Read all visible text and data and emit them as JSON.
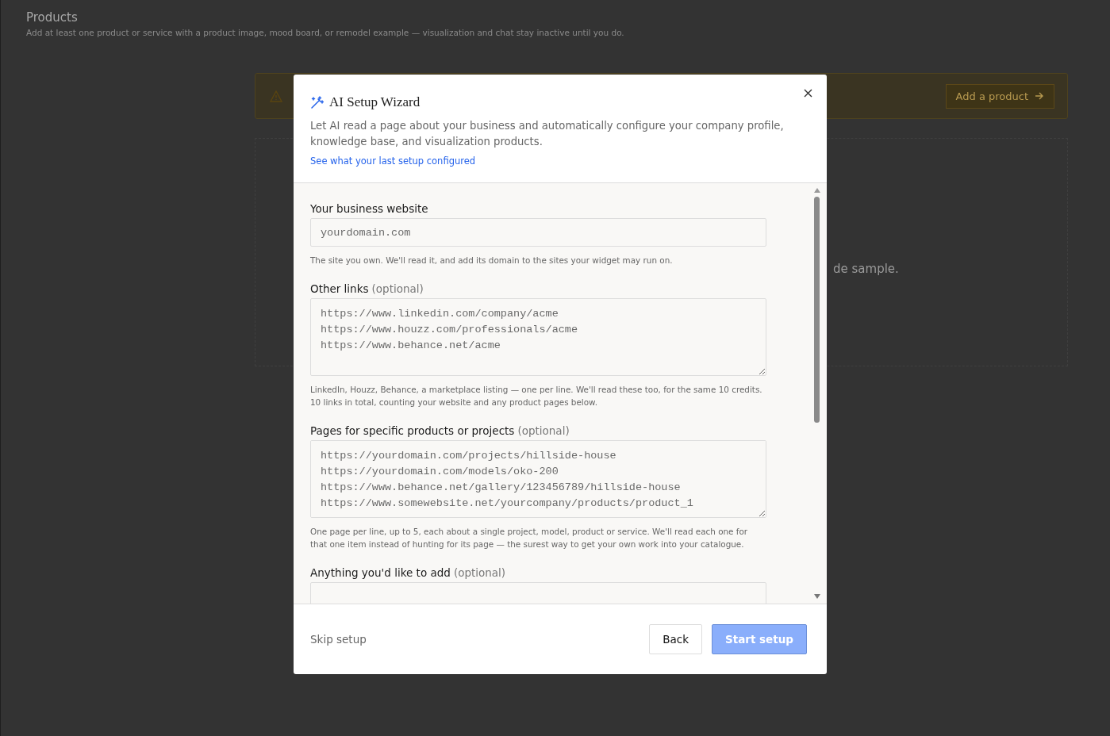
{
  "page": {
    "title": "Products",
    "subtitle": "Add at least one product or service with a product image, mood board, or remodel example — visualization and chat stay inactive until you do.",
    "banner": {
      "button": "Add a product"
    },
    "card": {
      "text": "de sample."
    }
  },
  "dialog": {
    "title": "AI Setup Wizard",
    "description": "Let AI read a page about your business and automatically configure your company profile, knowledge base, and visualization products.",
    "link": "See what your last setup configured",
    "fields": [
      {
        "kind": "input",
        "label": "Your business website",
        "placeholder": "yourdomain.com",
        "help": "The site you own. We'll read it, and add its domain to the sites your widget may run on."
      },
      {
        "kind": "textarea",
        "label": "Other links",
        "optional": "(optional)",
        "placeholder": "https://www.linkedin.com/company/acme\nhttps://www.houzz.com/professionals/acme\nhttps://www.behance.net/acme",
        "help": "LinkedIn, Houzz, Behance, a marketplace listing — one per line. We'll read these too, for the same 10 credits. 10 links in total, counting your website and any product pages below."
      },
      {
        "kind": "textarea",
        "label": "Pages for specific products or projects",
        "optional": "(optional)",
        "placeholder": "https://yourdomain.com/projects/hillside-house\nhttps://yourdomain.com/models/oko-200\nhttps://www.behance.net/gallery/123456789/hillside-house\nhttps://www.somewebsite.net/yourcompany/products/product_1",
        "help": "One page per line, up to 5, each about a single project, model, product or service. We'll read each one for that one item instead of hunting for its page — the surest way to get your own work into your catalogue."
      },
      {
        "kind": "textarea",
        "label": "Anything you'd like to add",
        "optional": "(optional)"
      }
    ],
    "footer": {
      "skip": "Skip setup",
      "back": "Back",
      "start": "Start setup",
      "start_disabled": true
    }
  }
}
